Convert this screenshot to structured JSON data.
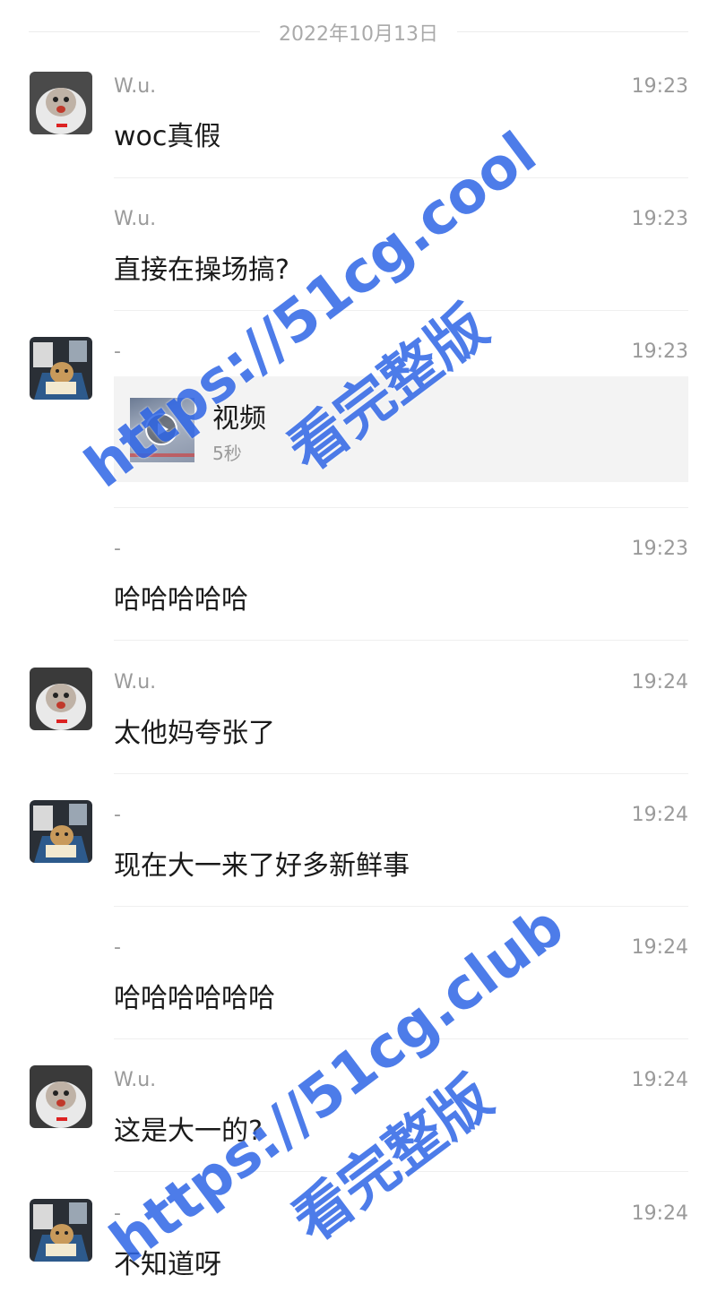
{
  "date_separator": "2022年10月13日",
  "messages": [
    {
      "name": "W.u.",
      "time": "19:23",
      "text": "woc真假",
      "avatar": "cat-hoodie"
    },
    {
      "name": "W.u.",
      "time": "19:23",
      "text": "直接在操场搞?"
    },
    {
      "name": "-",
      "time": "19:23",
      "avatar": "reading-bear",
      "video": {
        "title": "视频",
        "duration": "5秒"
      }
    },
    {
      "name": "-",
      "time": "19:23",
      "text": "哈哈哈哈哈"
    },
    {
      "name": "W.u.",
      "time": "19:24",
      "text": "太他妈夸张了",
      "avatar": "cat-hoodie"
    },
    {
      "name": "-",
      "time": "19:24",
      "text": "现在大一来了好多新鲜事",
      "avatar": "reading-bear"
    },
    {
      "name": "-",
      "time": "19:24",
      "text": "哈哈哈哈哈哈"
    },
    {
      "name": "W.u.",
      "time": "19:24",
      "text": "这是大一的?",
      "avatar": "cat-hoodie"
    },
    {
      "name": "-",
      "time": "19:24",
      "text": "不知道呀",
      "avatar": "reading-bear"
    }
  ],
  "watermarks": [
    {
      "url": "https://51cg.cool",
      "text": "看完整版"
    },
    {
      "url": "https://51cg.club",
      "text": "看完整版"
    }
  ]
}
